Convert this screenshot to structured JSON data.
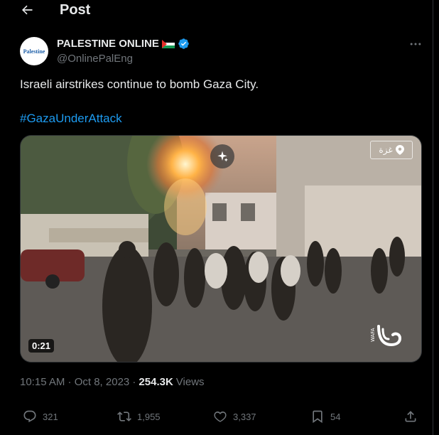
{
  "header": {
    "title": "Post"
  },
  "author": {
    "avatar_text": "Palestine",
    "name": "PALESTINE ONLINE",
    "handle": "@OnlinePalEng"
  },
  "tweet": {
    "text": "Israeli airstrikes continue to bomb Gaza City.",
    "hashtag": "#GazaUnderAttack"
  },
  "media": {
    "duration": "0:21",
    "location_label": "غزة",
    "watermark": "WAFA"
  },
  "meta": {
    "timestamp": "10:15 AM · Oct 8, 2023 · ",
    "views_count": "254.3K",
    "views_label": "Views"
  },
  "actions": {
    "replies": "321",
    "reposts": "1,955",
    "likes": "3,337",
    "bookmarks": "54"
  },
  "colors": {
    "background": "#000000",
    "text": "#e7e9ea",
    "muted": "#71767b",
    "accent": "#1d9bf0",
    "verified": "#1d9bf0"
  }
}
